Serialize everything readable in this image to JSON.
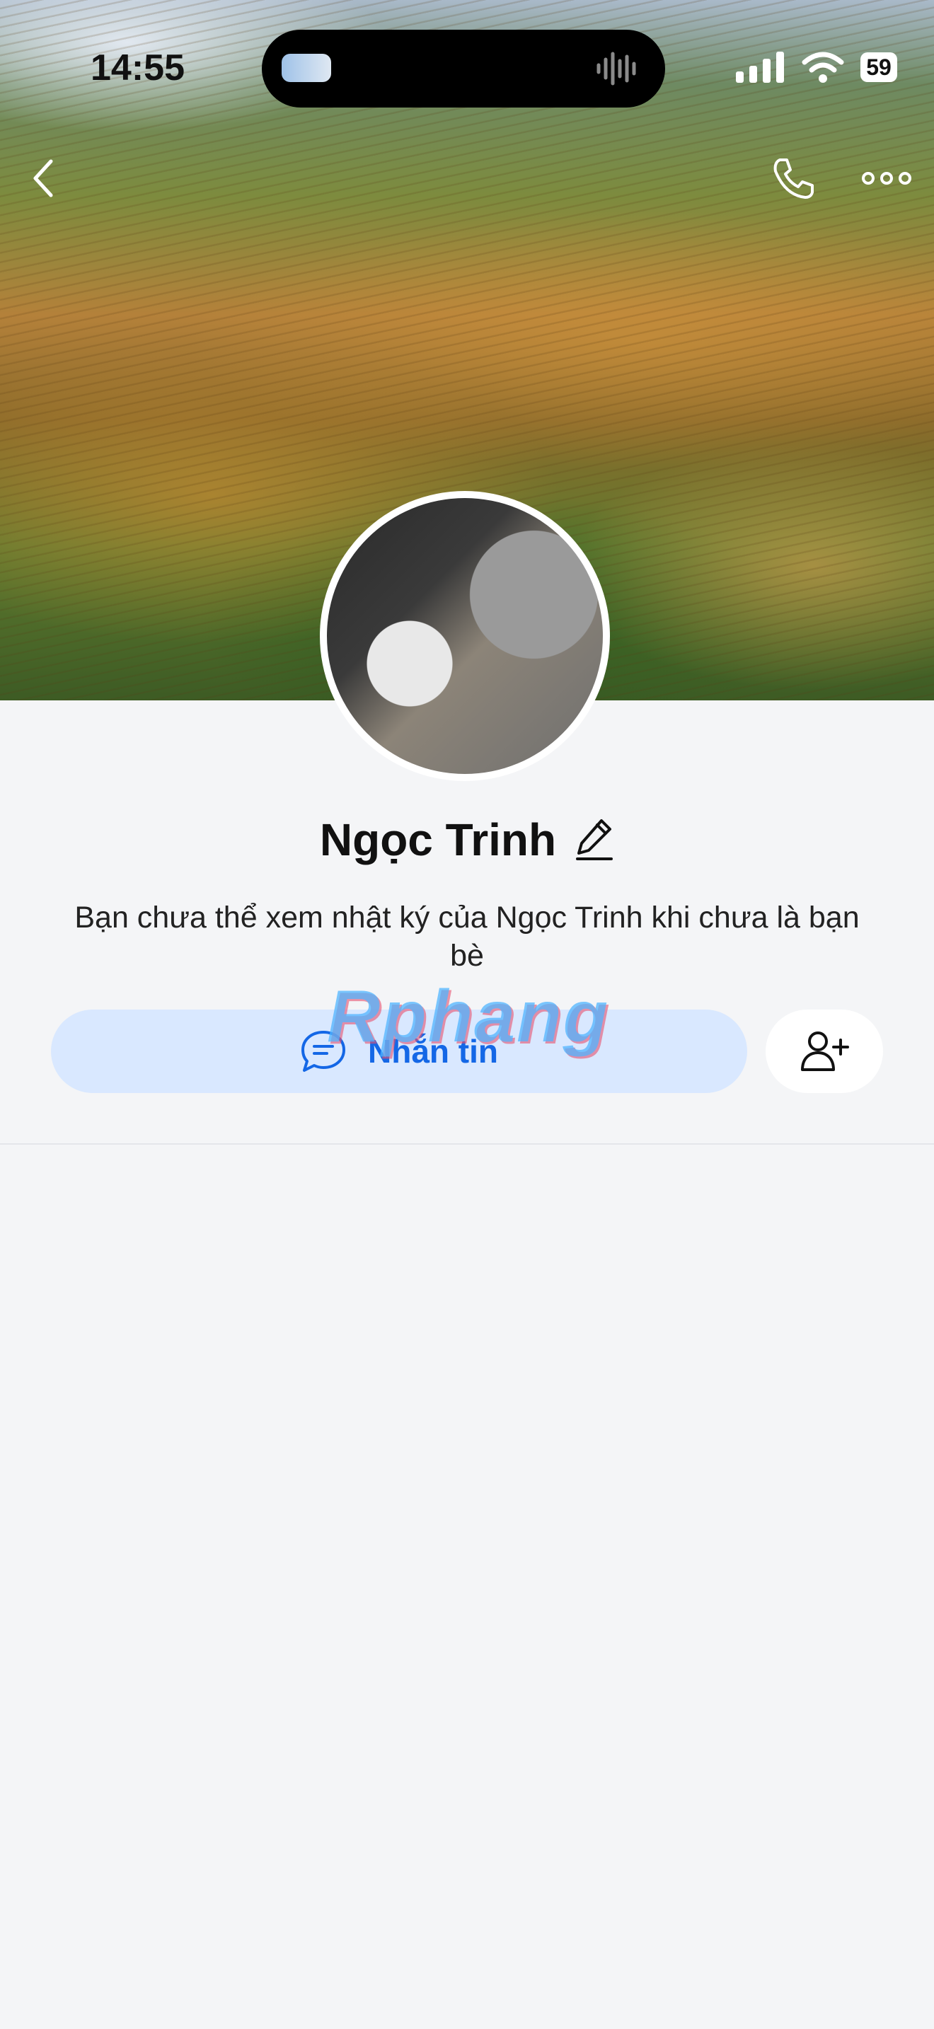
{
  "status_bar": {
    "time": "14:55",
    "battery": "59",
    "icons": [
      "dynamic-island-thumbnail",
      "audio-wave-icon",
      "signal-icon",
      "wifi-icon",
      "battery-icon"
    ]
  },
  "nav": {
    "back_icon": "chevron-left-icon",
    "call_icon": "phone-icon",
    "more_icon": "more-horizontal-icon"
  },
  "profile": {
    "name": "Ngọc Trinh",
    "edit_icon": "pencil-icon",
    "description": "Bạn chưa thể xem nhật ký của Ngọc Trinh khi chưa là bạn bè"
  },
  "actions": {
    "message_label": "Nhắn tin",
    "message_icon": "chat-bubble-icon",
    "add_friend_icon": "add-user-icon"
  },
  "watermark": "Rphang",
  "colors": {
    "accent": "#1467e6",
    "message_button_bg": "#d9e8ff",
    "page_bg": "#f4f5f7"
  }
}
